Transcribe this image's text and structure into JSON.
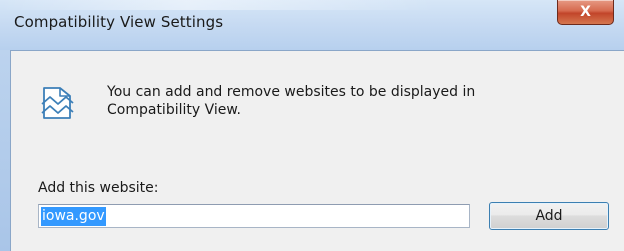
{
  "window": {
    "title": "Compatibility View Settings",
    "close_glyph": "X",
    "close_icon": "close-icon"
  },
  "info": {
    "icon": "compatibility-view-icon",
    "line1": "You can add and remove websites to be displayed in",
    "line2": "Compatibility View."
  },
  "form": {
    "label": "Add this website:",
    "website_value": "iowa.gov",
    "add_label": "Add"
  },
  "colors": {
    "selection": "#3399ff",
    "close_button": "#c7502f",
    "dialog_background": "#f0f0f0"
  }
}
